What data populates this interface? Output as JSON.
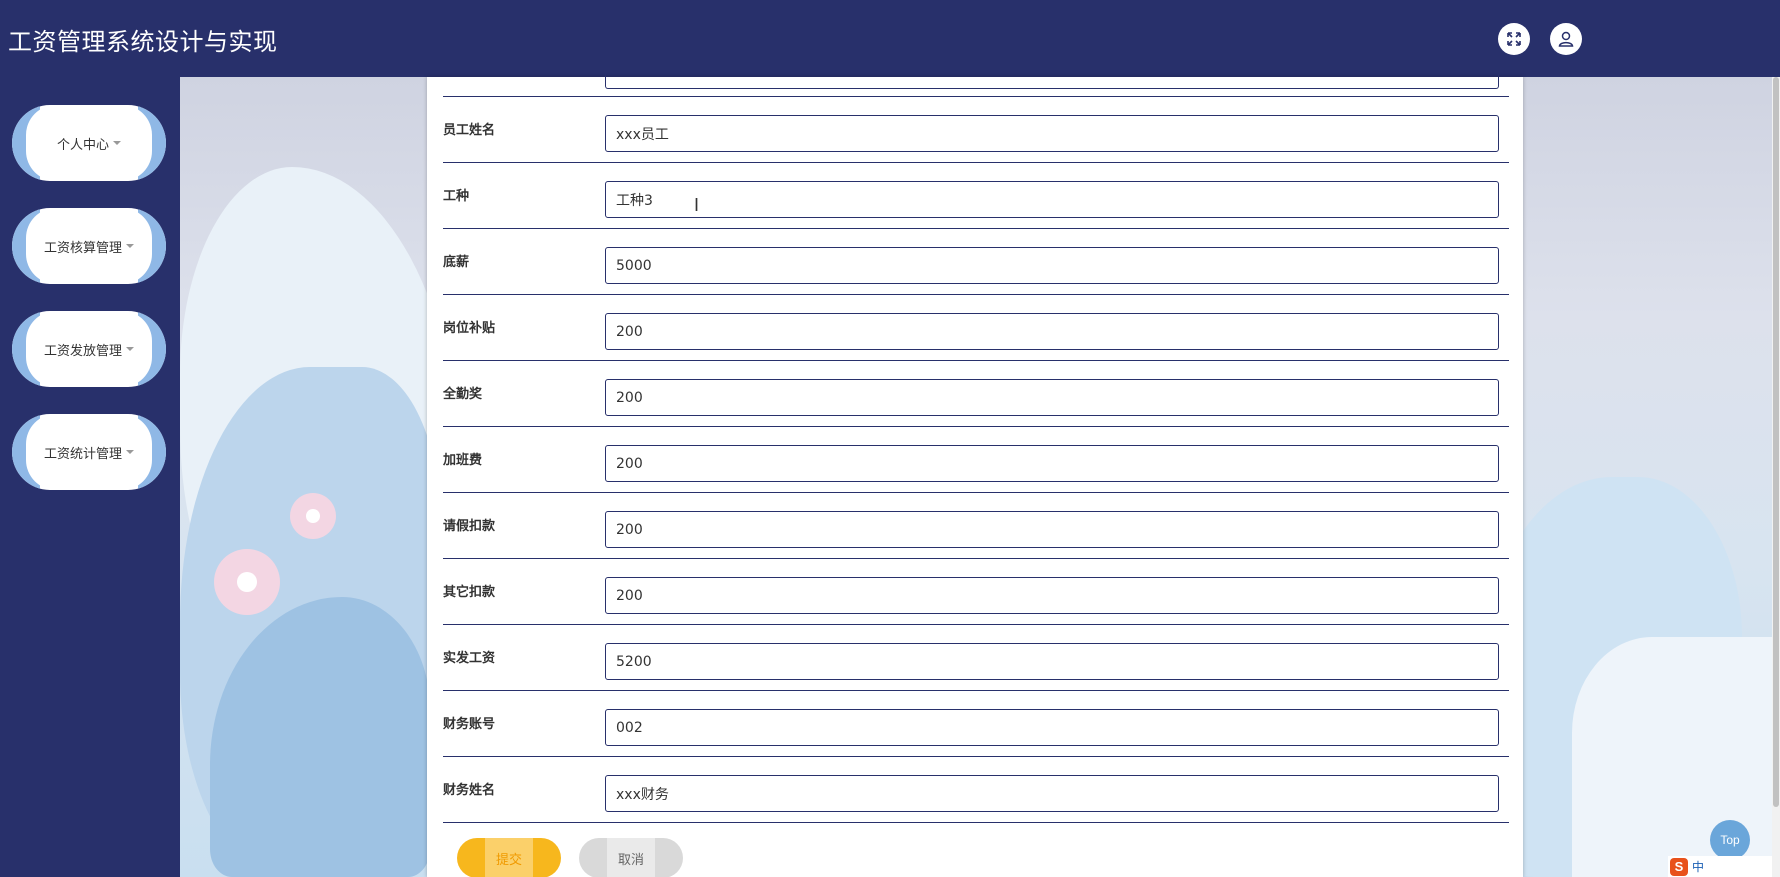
{
  "header": {
    "title": "工资管理系统设计与实现"
  },
  "sidebar": {
    "items": [
      {
        "label": "个人中心"
      },
      {
        "label": "工资核算管理"
      },
      {
        "label": "工资发放管理"
      },
      {
        "label": "工资统计管理"
      }
    ]
  },
  "form": {
    "fields": [
      {
        "label": "员工姓名",
        "value": "xxx员工"
      },
      {
        "label": "工种",
        "value": "工种3"
      },
      {
        "label": "底薪",
        "value": "5000"
      },
      {
        "label": "岗位补贴",
        "value": "200"
      },
      {
        "label": "全勤奖",
        "value": "200"
      },
      {
        "label": "加班费",
        "value": "200"
      },
      {
        "label": "请假扣款",
        "value": "200"
      },
      {
        "label": "其它扣款",
        "value": "200"
      },
      {
        "label": "实发工资",
        "value": "5200"
      },
      {
        "label": "财务账号",
        "value": "002"
      },
      {
        "label": "财务姓名",
        "value": "xxx财务"
      }
    ],
    "submit_label": "提交",
    "cancel_label": "取消"
  },
  "back_to_top_label": "Top",
  "ime": {
    "logo": "S",
    "mode": "中"
  },
  "colors": {
    "header_bg": "#28306b",
    "accent_yellow": "#f7b71d",
    "menu_side": "#8fb8e6"
  }
}
